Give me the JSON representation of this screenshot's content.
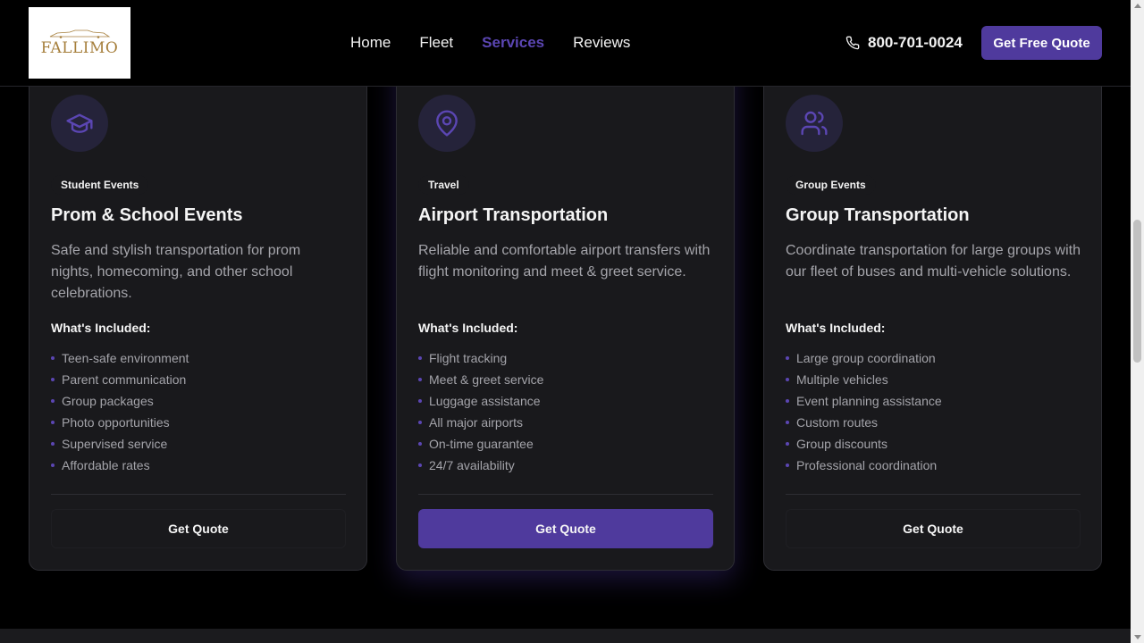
{
  "brand": {
    "logo_text": "FALLIMO"
  },
  "nav": {
    "items": [
      {
        "label": "Home"
      },
      {
        "label": "Fleet"
      },
      {
        "label": "Services"
      },
      {
        "label": "Reviews"
      }
    ],
    "active": "Services",
    "phone": "800-701-0024",
    "cta_label": "Get Free Quote"
  },
  "colors": {
    "accent": "#4f3a9d",
    "accent_text": "#5b46b3",
    "card_bg": "#19191c",
    "page_bg": "#000000"
  },
  "services": [
    {
      "icon": "graduation-cap-icon",
      "badge": "Student Events",
      "title": "Prom & School Events",
      "description": "Safe and stylish transportation for prom nights, homecoming, and other school celebrations.",
      "included_label": "What's Included:",
      "features": [
        "Teen-safe environment",
        "Parent communication",
        "Group packages",
        "Photo opportunities",
        "Supervised service",
        "Affordable rates"
      ],
      "button_label": "Get Quote"
    },
    {
      "icon": "map-pin-icon",
      "badge": "Travel",
      "title": "Airport Transportation",
      "description": "Reliable and comfortable airport transfers with flight monitoring and meet & greet service.",
      "included_label": "What's Included:",
      "features": [
        "Flight tracking",
        "Meet & greet service",
        "Luggage assistance",
        "All major airports",
        "On-time guarantee",
        "24/7 availability"
      ],
      "button_label": "Get Quote"
    },
    {
      "icon": "users-icon",
      "badge": "Group Events",
      "title": "Group Transportation",
      "description": "Coordinate transportation for large groups with our fleet of buses and multi-vehicle solutions.",
      "included_label": "What's Included:",
      "features": [
        "Large group coordination",
        "Multiple vehicles",
        "Event planning assistance",
        "Custom routes",
        "Group discounts",
        "Professional coordination"
      ],
      "button_label": "Get Quote"
    }
  ]
}
